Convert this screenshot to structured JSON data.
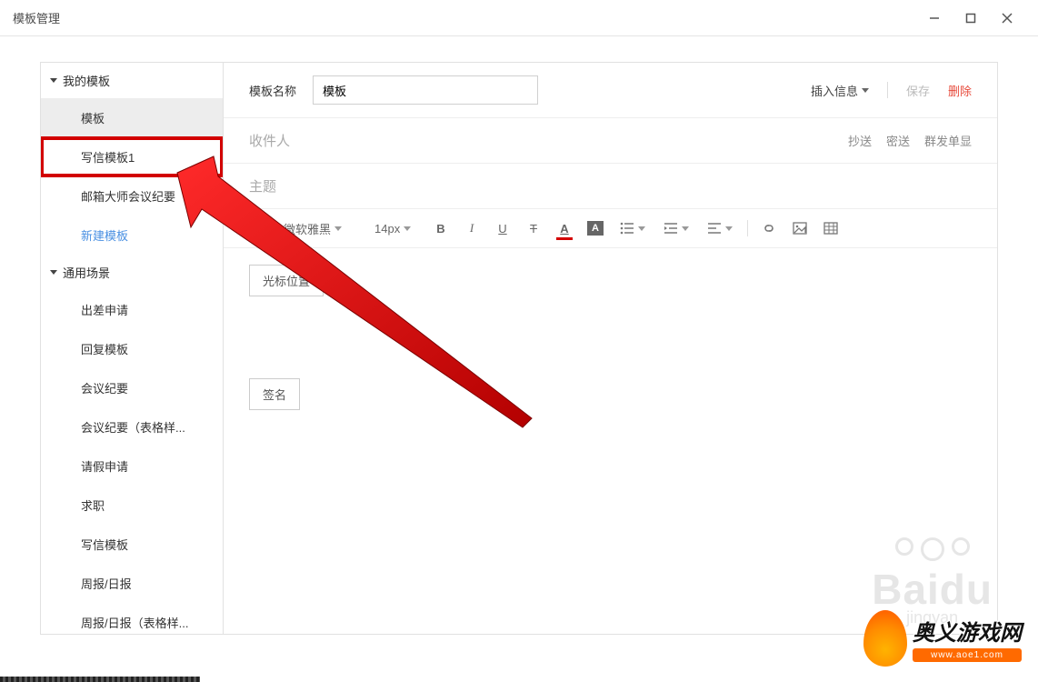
{
  "window": {
    "title": "模板管理"
  },
  "sidebar": {
    "my_templates_label": "我的模板",
    "common_scenes_label": "通用场景",
    "my_items": [
      {
        "label": "模板",
        "active": true
      },
      {
        "label": "写信模板1",
        "highlight": true
      },
      {
        "label": "邮箱大师会议纪要"
      }
    ],
    "new_template": "新建模板",
    "common_items": [
      {
        "label": "出差申请"
      },
      {
        "label": "回复模板"
      },
      {
        "label": "会议纪要"
      },
      {
        "label": "会议纪要（表格样..."
      },
      {
        "label": "请假申请"
      },
      {
        "label": "求职"
      },
      {
        "label": "写信模板"
      },
      {
        "label": "周报/日报"
      },
      {
        "label": "周报/日报（表格样..."
      }
    ]
  },
  "header": {
    "name_label": "模板名称",
    "name_value": "模板",
    "insert_info": "插入信息",
    "save": "保存",
    "delete": "删除"
  },
  "fields": {
    "recipient": "收件人",
    "subject": "主题",
    "cc": "抄送",
    "bcc": "密送",
    "mass_send": "群发单显"
  },
  "toolbar": {
    "font_family": "微软雅黑",
    "font_size": "14px"
  },
  "editor": {
    "btn1": "光标位置",
    "btn2": "签名"
  },
  "watermark": {
    "brand": "Baidu",
    "sub": "jingyan"
  },
  "logo": {
    "cn": "奥义游戏网",
    "en": "www.aoe1.com"
  }
}
